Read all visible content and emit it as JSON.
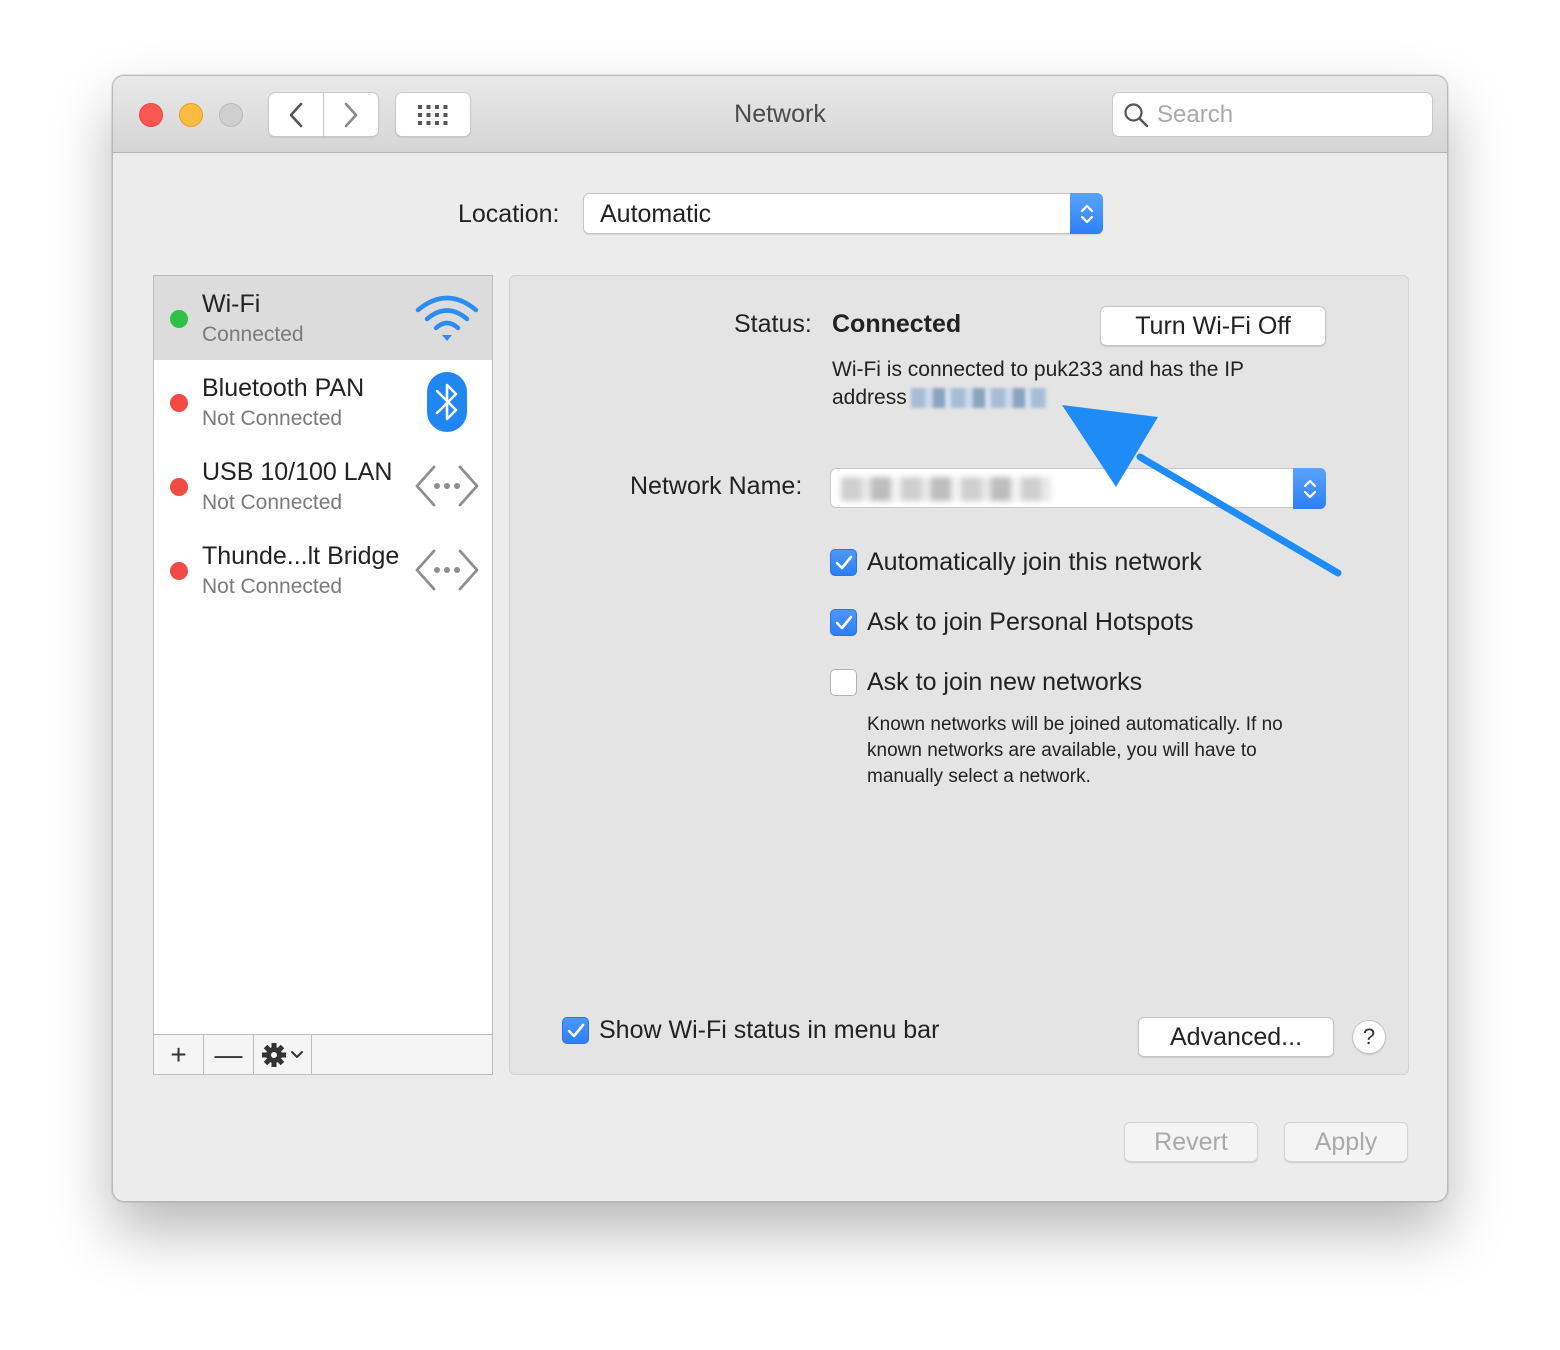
{
  "window": {
    "title": "Network"
  },
  "toolbar": {
    "search_placeholder": "Search"
  },
  "location": {
    "label": "Location:",
    "value": "Automatic"
  },
  "sidebar": {
    "items": [
      {
        "name": "Wi-Fi",
        "status": "Connected",
        "status_color": "#2fc146",
        "icon": "wifi-icon",
        "selected": true
      },
      {
        "name": "Bluetooth PAN",
        "status": "Not Connected",
        "status_color": "#f24a45",
        "icon": "bluetooth-icon"
      },
      {
        "name": "USB 10/100 LAN",
        "status": "Not Connected",
        "status_color": "#f24a45",
        "icon": "ethernet-icon"
      },
      {
        "name": "Thunde...lt Bridge",
        "status": "Not Connected",
        "status_color": "#f24a45",
        "icon": "ethernet-icon"
      }
    ],
    "add_label": "+",
    "remove_label": "—"
  },
  "panel": {
    "status_label": "Status:",
    "status_value": "Connected",
    "turn_off_label": "Turn Wi-Fi Off",
    "description": "Wi-Fi is connected to puk233 and has the IP address",
    "network_name_label": "Network Name:",
    "auto_join_label": "Automatically join this network",
    "auto_join_checked": true,
    "hotspots_label": "Ask to join Personal Hotspots",
    "hotspots_checked": true,
    "new_networks_label": "Ask to join new networks",
    "new_networks_checked": false,
    "hint": "Known networks will be joined automatically. If no known networks are available, you will have to manually select a network.",
    "menubar_label": "Show Wi-Fi status in menu bar",
    "menubar_checked": true,
    "advanced_label": "Advanced...",
    "help_label": "?"
  },
  "footer": {
    "revert_label": "Revert",
    "apply_label": "Apply"
  },
  "colors": {
    "accent": "#2b7ef6",
    "annotation_arrow": "#1e8cf7"
  }
}
